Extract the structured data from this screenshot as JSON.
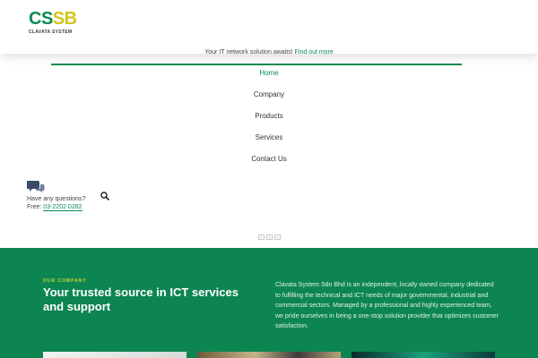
{
  "header": {
    "logo": {
      "letters_green": "CS",
      "letters_yellow": "SB",
      "subtitle": "CLAVATA SYSTEM"
    },
    "top_note": {
      "text": "Your IT network solution awaits!",
      "link": "Find out more"
    }
  },
  "nav": {
    "items": [
      {
        "label": "Home",
        "active": true
      },
      {
        "label": "Company",
        "active": false
      },
      {
        "label": "Products",
        "active": false
      },
      {
        "label": "Services",
        "active": false
      },
      {
        "label": "Contact Us",
        "active": false
      }
    ]
  },
  "contact": {
    "question": "Have any questions?",
    "free_label": "Free:",
    "phone": "03-2202 0282",
    "icons": [
      "chat-bubbles-icon",
      "search-icon"
    ]
  },
  "slider": {
    "dots": [
      "•",
      "•",
      "•"
    ]
  },
  "company": {
    "eyebrow": "OUR COMPANY",
    "headline": "Your trusted source in ICT services and support",
    "description": "Clavata System Sdn Bhd is an independent, locally owned company dedicated to fulfilling the technical and ICT needs of major governmental, industrial and commercial sectors. Managed by a professional and highly experienced team, we pride ourselves in being a one-stop solution provider that optimizes customer satisfaction."
  },
  "colors": {
    "brand_green": "#0d8551",
    "accent_yellow": "#d3c61b",
    "eyebrow": "#c6d832"
  }
}
